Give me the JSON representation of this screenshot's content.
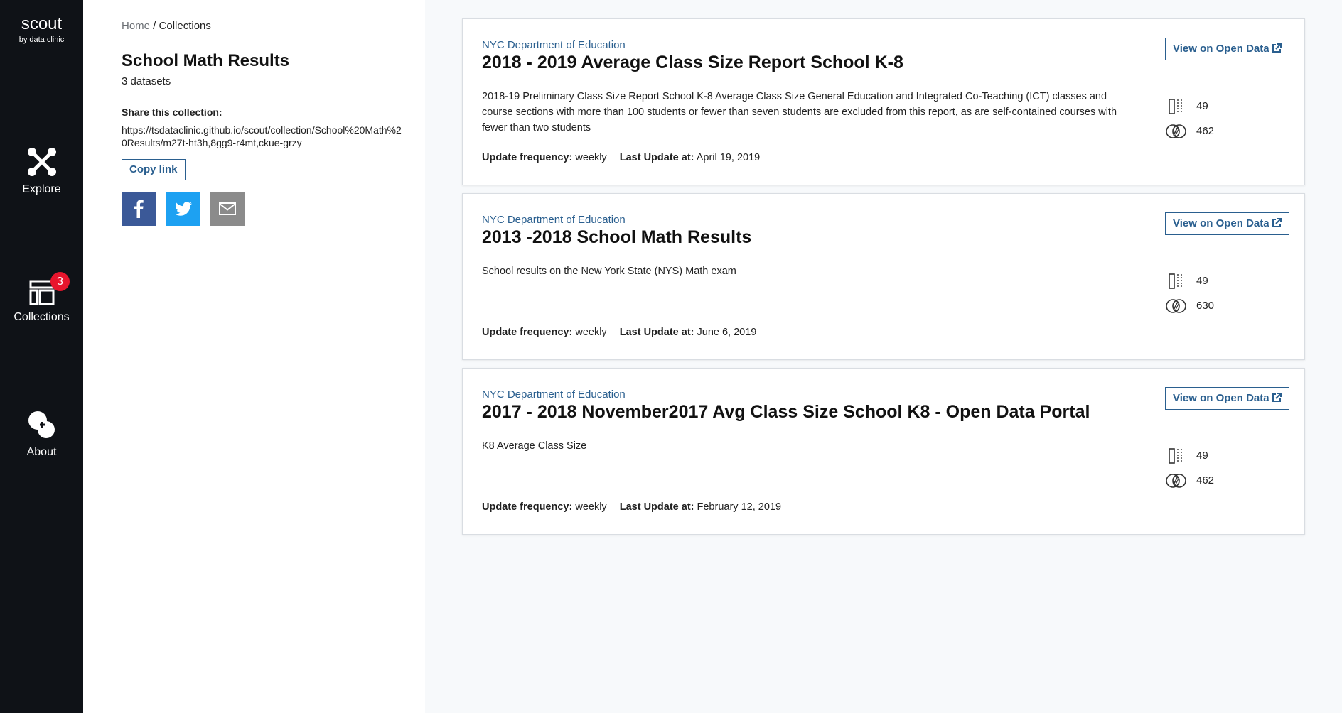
{
  "nav": {
    "brand": "scout",
    "brand_sub": "by data clinic",
    "items": [
      {
        "label": "Explore",
        "icon": "explore-icon"
      },
      {
        "label": "Collections",
        "icon": "collections-icon",
        "badge": "3"
      },
      {
        "label": "About",
        "icon": "about-icon"
      }
    ]
  },
  "panel": {
    "breadcrumb_home": "Home",
    "breadcrumb_sep": " / ",
    "breadcrumb_current": "Collections",
    "title": "School Math Results",
    "count": "3 datasets",
    "share_label": "Share this collection:",
    "share_url": "https://tsdataclinic.github.io/scout/collection/School%20Math%20Results/m27t-ht3h,8gg9-r4mt,ckue-grzy",
    "copy_label": "Copy link",
    "social": [
      "facebook-icon",
      "twitter-icon",
      "email-icon"
    ]
  },
  "colors": {
    "nav_bg": "#0f1217",
    "accent": "#2a5f8f",
    "badge": "#e8152d",
    "facebook": "#3b5998",
    "twitter": "#1da1f2",
    "email": "#8b8b8b"
  },
  "datasets": [
    {
      "agency": "NYC Department of Education",
      "title": "2018 - 2019 Average Class Size Report School K-8",
      "description": "2018-19 Preliminary Class Size Report School K-8 Average Class Size General Education and Integrated Co-Teaching (ICT) classes and course sections with more than 100 students or fewer than seven students are excluded from this report, as are self-contained courses with fewer than two students",
      "update_frequency_label": "Update frequency:",
      "update_frequency": "weekly",
      "last_update_label": "Last Update at:",
      "last_update": "April 19, 2019",
      "view_label": "View on Open Data",
      "columns": "49",
      "rows": "462"
    },
    {
      "agency": "NYC Department of Education",
      "title": "2013 -2018 School Math Results",
      "description": "School results on the New York State (NYS) Math exam",
      "update_frequency_label": "Update frequency:",
      "update_frequency": "weekly",
      "last_update_label": "Last Update at:",
      "last_update": "June 6, 2019",
      "view_label": "View on Open Data",
      "columns": "49",
      "rows": "630"
    },
    {
      "agency": "NYC Department of Education",
      "title": "2017 - 2018 November2017 Avg Class Size School K8 - Open Data Portal",
      "description": "K8 Average Class Size",
      "update_frequency_label": "Update frequency:",
      "update_frequency": "weekly",
      "last_update_label": "Last Update at:",
      "last_update": "February 12, 2019",
      "view_label": "View on Open Data",
      "columns": "49",
      "rows": "462"
    }
  ]
}
